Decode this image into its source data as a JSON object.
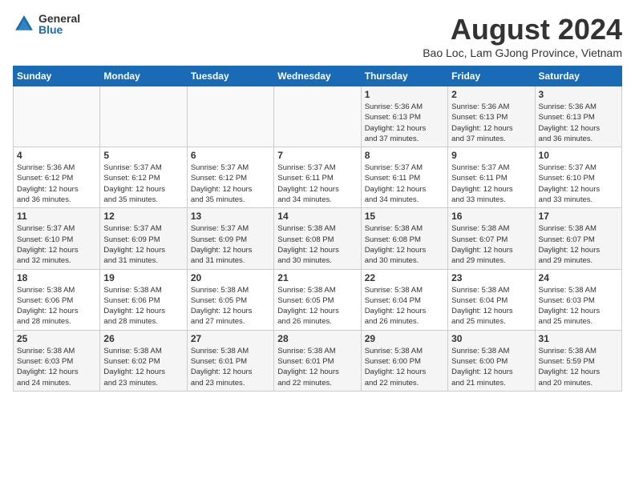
{
  "header": {
    "logo_general": "General",
    "logo_blue": "Blue",
    "month_title": "August 2024",
    "location": "Bao Loc, Lam GJong Province, Vietnam"
  },
  "days_of_week": [
    "Sunday",
    "Monday",
    "Tuesday",
    "Wednesday",
    "Thursday",
    "Friday",
    "Saturday"
  ],
  "weeks": [
    [
      {
        "day": "",
        "info": ""
      },
      {
        "day": "",
        "info": ""
      },
      {
        "day": "",
        "info": ""
      },
      {
        "day": "",
        "info": ""
      },
      {
        "day": "1",
        "info": "Sunrise: 5:36 AM\nSunset: 6:13 PM\nDaylight: 12 hours\nand 37 minutes."
      },
      {
        "day": "2",
        "info": "Sunrise: 5:36 AM\nSunset: 6:13 PM\nDaylight: 12 hours\nand 37 minutes."
      },
      {
        "day": "3",
        "info": "Sunrise: 5:36 AM\nSunset: 6:13 PM\nDaylight: 12 hours\nand 36 minutes."
      }
    ],
    [
      {
        "day": "4",
        "info": "Sunrise: 5:36 AM\nSunset: 6:12 PM\nDaylight: 12 hours\nand 36 minutes."
      },
      {
        "day": "5",
        "info": "Sunrise: 5:37 AM\nSunset: 6:12 PM\nDaylight: 12 hours\nand 35 minutes."
      },
      {
        "day": "6",
        "info": "Sunrise: 5:37 AM\nSunset: 6:12 PM\nDaylight: 12 hours\nand 35 minutes."
      },
      {
        "day": "7",
        "info": "Sunrise: 5:37 AM\nSunset: 6:11 PM\nDaylight: 12 hours\nand 34 minutes."
      },
      {
        "day": "8",
        "info": "Sunrise: 5:37 AM\nSunset: 6:11 PM\nDaylight: 12 hours\nand 34 minutes."
      },
      {
        "day": "9",
        "info": "Sunrise: 5:37 AM\nSunset: 6:11 PM\nDaylight: 12 hours\nand 33 minutes."
      },
      {
        "day": "10",
        "info": "Sunrise: 5:37 AM\nSunset: 6:10 PM\nDaylight: 12 hours\nand 33 minutes."
      }
    ],
    [
      {
        "day": "11",
        "info": "Sunrise: 5:37 AM\nSunset: 6:10 PM\nDaylight: 12 hours\nand 32 minutes."
      },
      {
        "day": "12",
        "info": "Sunrise: 5:37 AM\nSunset: 6:09 PM\nDaylight: 12 hours\nand 31 minutes."
      },
      {
        "day": "13",
        "info": "Sunrise: 5:37 AM\nSunset: 6:09 PM\nDaylight: 12 hours\nand 31 minutes."
      },
      {
        "day": "14",
        "info": "Sunrise: 5:38 AM\nSunset: 6:08 PM\nDaylight: 12 hours\nand 30 minutes."
      },
      {
        "day": "15",
        "info": "Sunrise: 5:38 AM\nSunset: 6:08 PM\nDaylight: 12 hours\nand 30 minutes."
      },
      {
        "day": "16",
        "info": "Sunrise: 5:38 AM\nSunset: 6:07 PM\nDaylight: 12 hours\nand 29 minutes."
      },
      {
        "day": "17",
        "info": "Sunrise: 5:38 AM\nSunset: 6:07 PM\nDaylight: 12 hours\nand 29 minutes."
      }
    ],
    [
      {
        "day": "18",
        "info": "Sunrise: 5:38 AM\nSunset: 6:06 PM\nDaylight: 12 hours\nand 28 minutes."
      },
      {
        "day": "19",
        "info": "Sunrise: 5:38 AM\nSunset: 6:06 PM\nDaylight: 12 hours\nand 28 minutes."
      },
      {
        "day": "20",
        "info": "Sunrise: 5:38 AM\nSunset: 6:05 PM\nDaylight: 12 hours\nand 27 minutes."
      },
      {
        "day": "21",
        "info": "Sunrise: 5:38 AM\nSunset: 6:05 PM\nDaylight: 12 hours\nand 26 minutes."
      },
      {
        "day": "22",
        "info": "Sunrise: 5:38 AM\nSunset: 6:04 PM\nDaylight: 12 hours\nand 26 minutes."
      },
      {
        "day": "23",
        "info": "Sunrise: 5:38 AM\nSunset: 6:04 PM\nDaylight: 12 hours\nand 25 minutes."
      },
      {
        "day": "24",
        "info": "Sunrise: 5:38 AM\nSunset: 6:03 PM\nDaylight: 12 hours\nand 25 minutes."
      }
    ],
    [
      {
        "day": "25",
        "info": "Sunrise: 5:38 AM\nSunset: 6:03 PM\nDaylight: 12 hours\nand 24 minutes."
      },
      {
        "day": "26",
        "info": "Sunrise: 5:38 AM\nSunset: 6:02 PM\nDaylight: 12 hours\nand 23 minutes."
      },
      {
        "day": "27",
        "info": "Sunrise: 5:38 AM\nSunset: 6:01 PM\nDaylight: 12 hours\nand 23 minutes."
      },
      {
        "day": "28",
        "info": "Sunrise: 5:38 AM\nSunset: 6:01 PM\nDaylight: 12 hours\nand 22 minutes."
      },
      {
        "day": "29",
        "info": "Sunrise: 5:38 AM\nSunset: 6:00 PM\nDaylight: 12 hours\nand 22 minutes."
      },
      {
        "day": "30",
        "info": "Sunrise: 5:38 AM\nSunset: 6:00 PM\nDaylight: 12 hours\nand 21 minutes."
      },
      {
        "day": "31",
        "info": "Sunrise: 5:38 AM\nSunset: 5:59 PM\nDaylight: 12 hours\nand 20 minutes."
      }
    ]
  ]
}
